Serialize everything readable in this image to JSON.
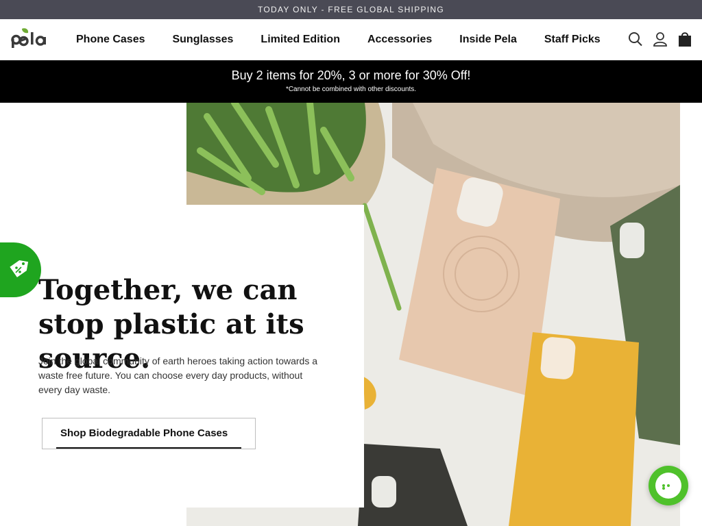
{
  "announcement": "TODAY ONLY - FREE GLOBAL SHIPPING",
  "header": {
    "logo_text": "pela",
    "nav": [
      "Phone Cases",
      "Sunglasses",
      "Limited Edition",
      "Accessories",
      "Inside Pela",
      "Staff Picks"
    ],
    "icons": [
      "search-icon",
      "account-icon",
      "cart-icon"
    ]
  },
  "promo": {
    "main": "Buy 2 items for 20%, 3 or more for 30% Off!",
    "note": "*Cannot be combined with other discounts."
  },
  "hero": {
    "title": "Together, we can stop plastic at its source.",
    "text": "Join the global community of earth heroes taking action towards a waste free future. You can choose every day products, without every day waste.",
    "cta": "Shop Biodegradable Phone Cases"
  },
  "widgets": {
    "discount_icon": "discount-tag-icon",
    "chat_icon": "chat-icon"
  },
  "colors": {
    "announcement_bg": "#4a4a55",
    "promo_bg": "#000000",
    "brand_green": "#6fab34",
    "discount_tab": "#1fa51f",
    "chat_bubble": "#4fc12b"
  }
}
